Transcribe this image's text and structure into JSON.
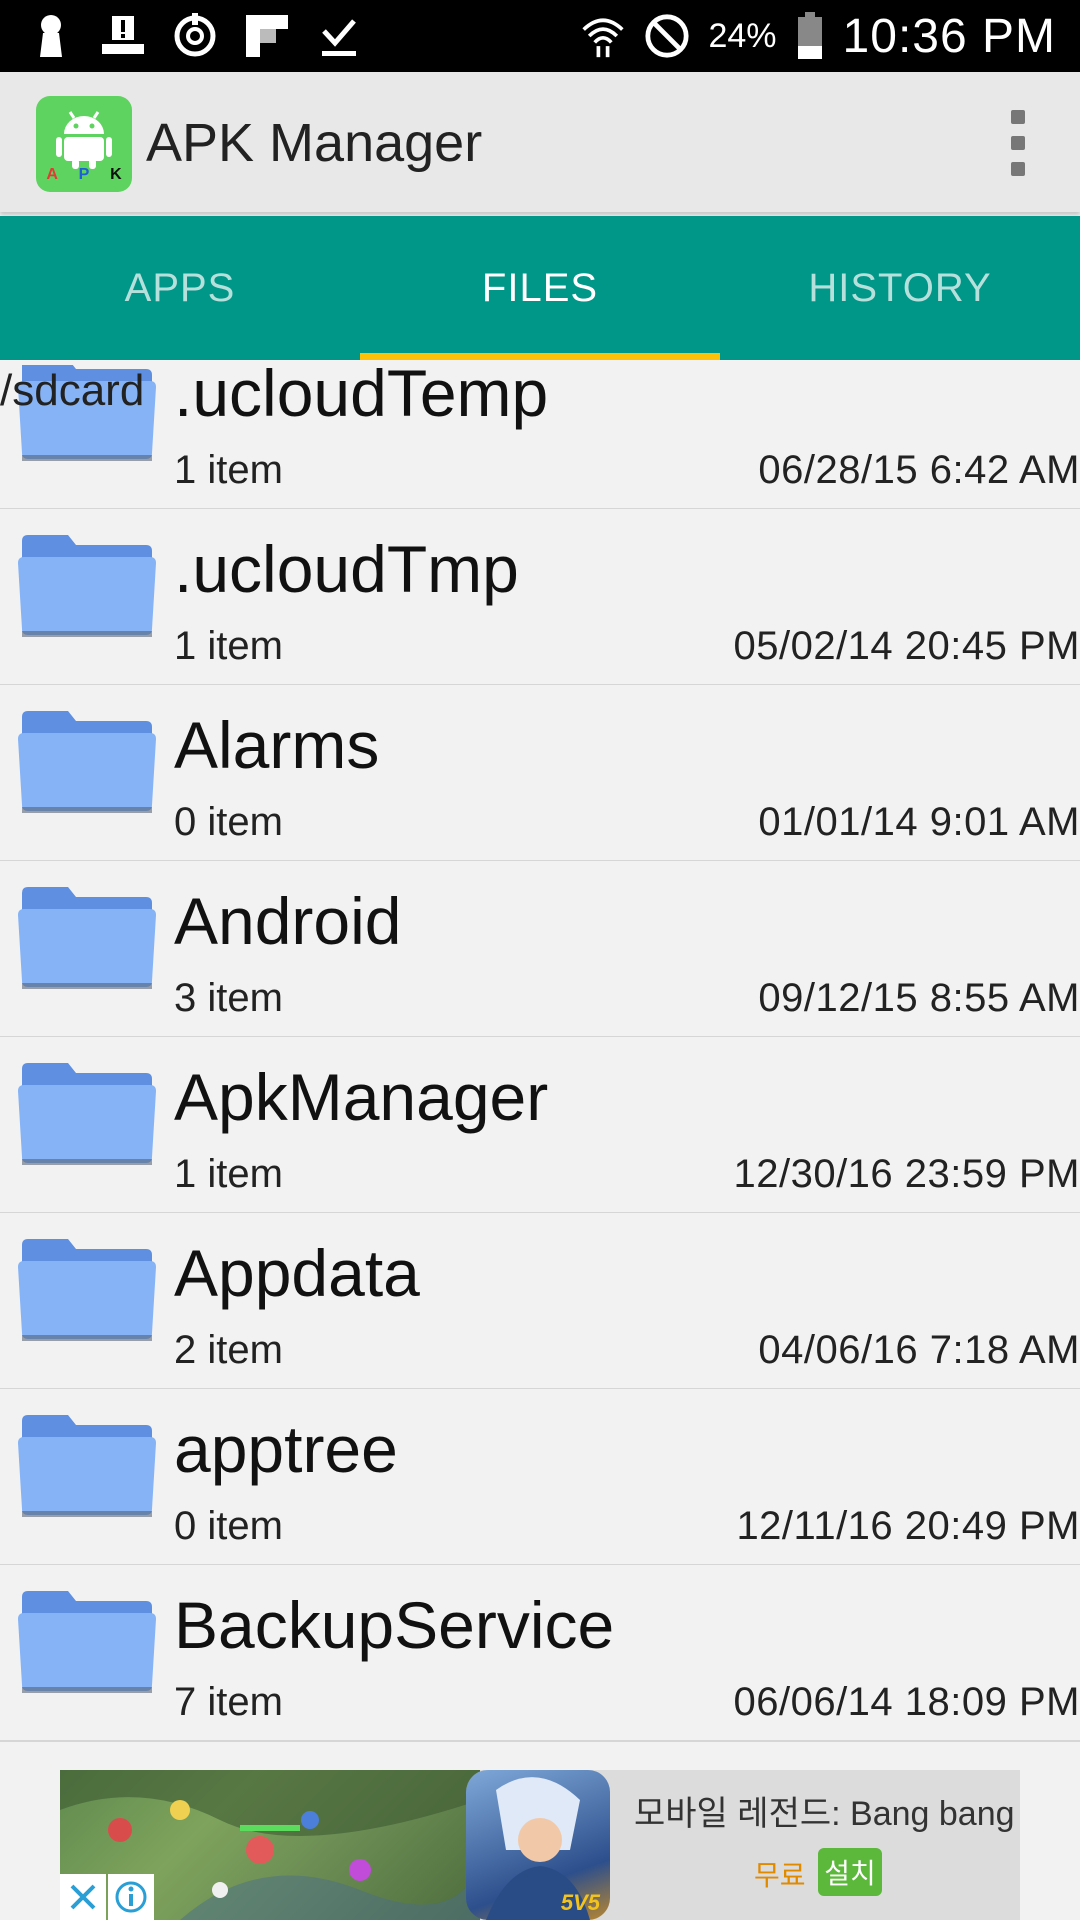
{
  "status_bar": {
    "icons": [
      "keyhole-icon",
      "alert-tray-icon",
      "sync-circle-icon",
      "flipboard-icon",
      "download-done-icon"
    ],
    "right_icons": [
      "wifi-icon",
      "no-disturb-icon",
      "battery-icon"
    ],
    "battery": "24%",
    "time": "10:36 PM"
  },
  "app_bar": {
    "title": "APK Manager",
    "logo_letters": [
      "A",
      "P",
      "K"
    ],
    "menu_icon": "overflow-menu-icon"
  },
  "tabs": [
    {
      "label": "APPS",
      "active": false
    },
    {
      "label": "FILES",
      "active": true
    },
    {
      "label": "HISTORY",
      "active": false
    }
  ],
  "path": "/sdcard",
  "files": [
    {
      "name": ".ucloudTemp",
      "count": "1 item",
      "date": "06/28/15 6:42 AM"
    },
    {
      "name": ".ucloudTmp",
      "count": "1 item",
      "date": "05/02/14 20:45 PM"
    },
    {
      "name": "Alarms",
      "count": "0 item",
      "date": "01/01/14 9:01 AM"
    },
    {
      "name": "Android",
      "count": "3 item",
      "date": "09/12/15 8:55 AM"
    },
    {
      "name": "ApkManager",
      "count": "1 item",
      "date": "12/30/16 23:59 PM"
    },
    {
      "name": "Appdata",
      "count": "2 item",
      "date": "04/06/16 7:18 AM"
    },
    {
      "name": "apptree",
      "count": "0 item",
      "date": "12/11/16 20:49 PM"
    },
    {
      "name": "BackupService",
      "count": "7 item",
      "date": "06/06/14 18:09 PM"
    }
  ],
  "ad": {
    "title": "모바일 레전드: Bang bang",
    "price": "무료",
    "install": "설치",
    "hero_badge": "5V5"
  },
  "colors": {
    "tab_bar": "#009688",
    "tab_indicator": "#ffc107",
    "folder": "#7aa8f0"
  }
}
